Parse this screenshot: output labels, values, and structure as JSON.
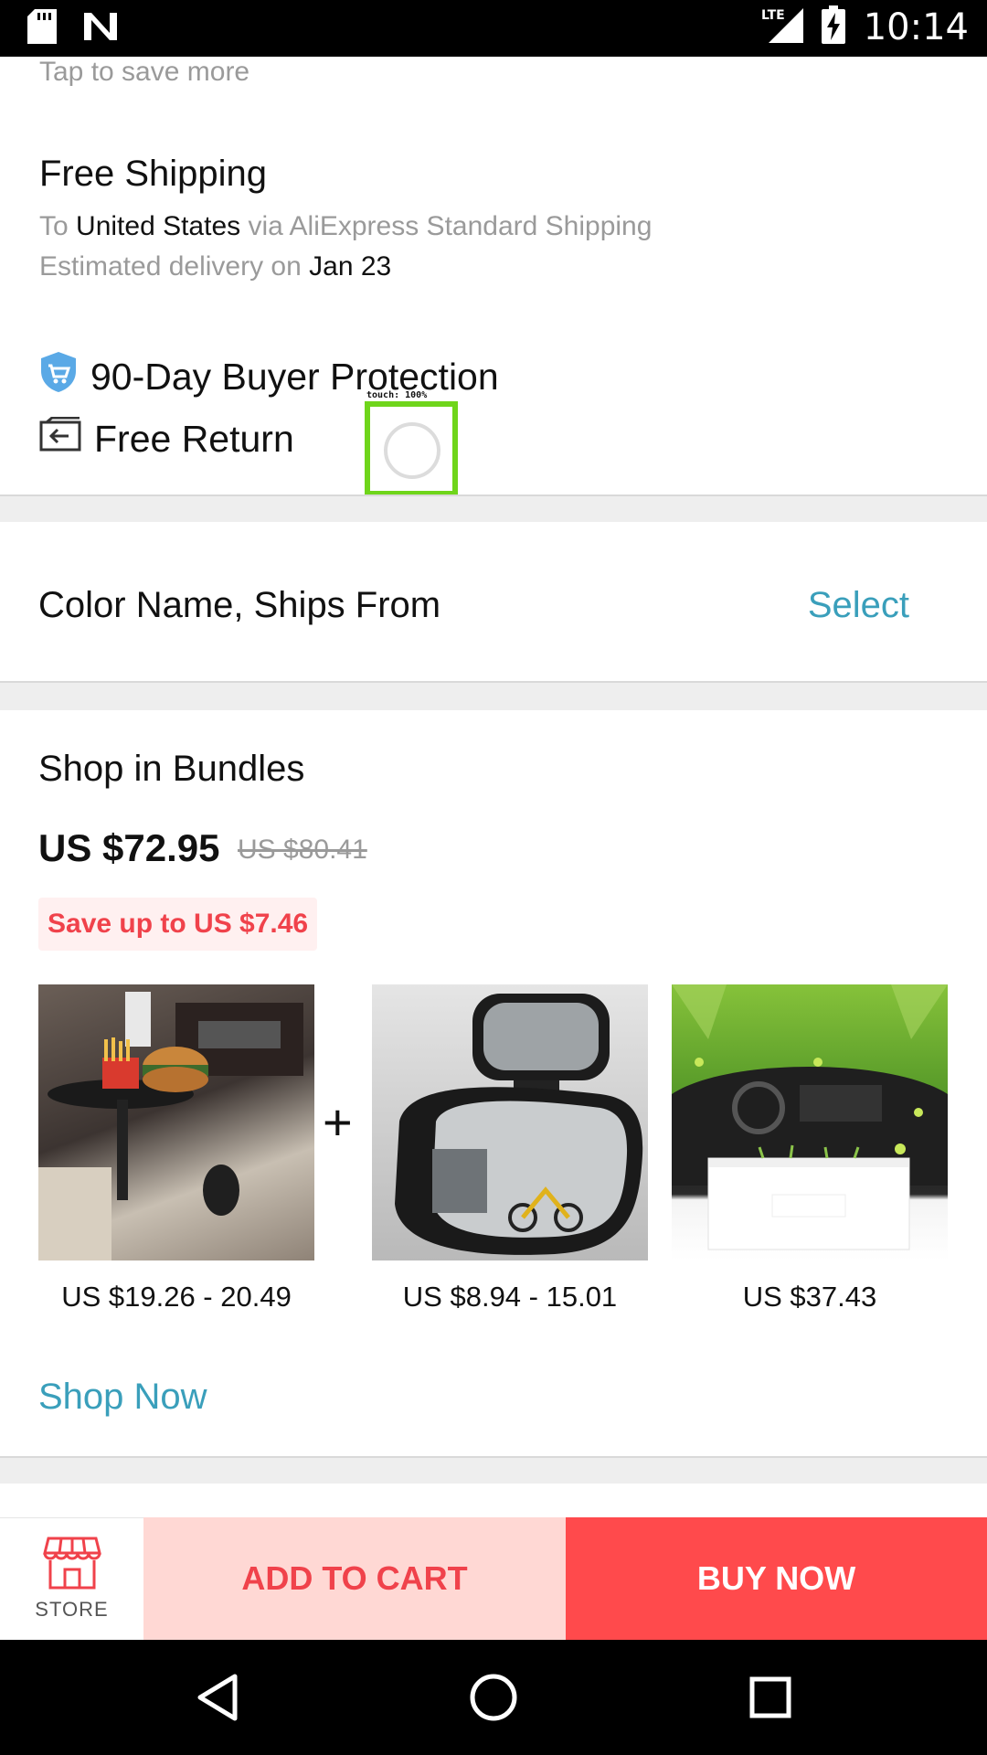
{
  "status_bar": {
    "time": "10:14",
    "network": "LTE",
    "icons": [
      "sd-card-icon",
      "n-logo-icon",
      "signal-icon",
      "battery-charging-icon"
    ]
  },
  "header": {
    "tap_to_save": "Tap to save more"
  },
  "shipping": {
    "title": "Free Shipping",
    "to_prefix": "To",
    "destination": "United States",
    "via": "via AliExpress Standard Shipping",
    "delivery_prefix": "Estimated delivery on",
    "delivery_date": "Jan 23"
  },
  "protection": {
    "buyer_protection": "90-Day Buyer Protection",
    "free_return": "Free Return"
  },
  "touch_overlay": {
    "label": "touch: 100%"
  },
  "variant": {
    "label": "Color Name, Ships From",
    "action": "Select"
  },
  "bundles": {
    "title": "Shop in Bundles",
    "price": "US $72.95",
    "original_price": "US $80.41",
    "save_text": "Save up to US $7.46",
    "plus": "+",
    "products": [
      {
        "price": "US $19.26 - 20.49"
      },
      {
        "price": "US $8.94 - 15.01"
      },
      {
        "price": "US $37.43"
      }
    ],
    "shop_now": "Shop Now"
  },
  "actions": {
    "store_label": "STORE",
    "add_to_cart": "ADD TO CART",
    "buy_now": "BUY NOW"
  },
  "colors": {
    "accent_link": "#3a9fbb",
    "sale_red": "#f0424b",
    "buy_red": "#ff4a4c",
    "cart_pink": "#ffd8d4"
  }
}
